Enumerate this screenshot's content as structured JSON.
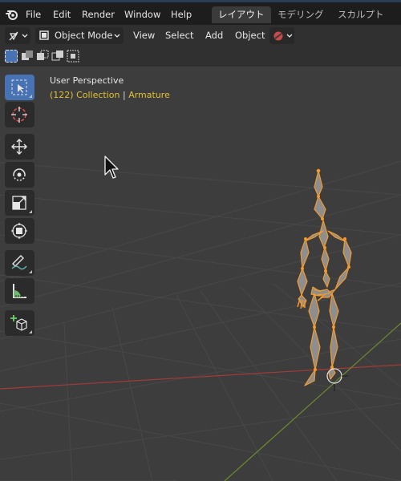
{
  "app": {
    "name": "Blender"
  },
  "top_menu": {
    "items": [
      {
        "label": "File"
      },
      {
        "label": "Edit"
      },
      {
        "label": "Render"
      },
      {
        "label": "Window"
      },
      {
        "label": "Help"
      }
    ]
  },
  "workspace_tabs": [
    {
      "label": "レイアウト",
      "active": true
    },
    {
      "label": "モデリング",
      "active": false
    },
    {
      "label": "スカルプト",
      "active": false
    }
  ],
  "header": {
    "editor_type_icon": "view3d-icon",
    "mode_label": "Object Mode",
    "menus": [
      {
        "label": "View"
      },
      {
        "label": "Select"
      },
      {
        "label": "Add"
      },
      {
        "label": "Object"
      }
    ],
    "overlay_icon": "shading-icon"
  },
  "select_modes": [
    "select-new-icon",
    "select-extend-icon",
    "select-subtract-icon",
    "select-invert-icon",
    "select-intersect-icon"
  ],
  "tools": [
    {
      "name": "select-box-icon",
      "active": true
    },
    {
      "name": "cursor-icon",
      "active": false
    },
    {
      "name": "move-icon",
      "active": false
    },
    {
      "name": "rotate-icon",
      "active": false
    },
    {
      "name": "scale-icon",
      "active": false
    },
    {
      "name": "transform-icon",
      "active": false
    },
    {
      "name": "annotate-icon",
      "active": false
    },
    {
      "name": "measure-icon",
      "active": false
    },
    {
      "name": "add-cube-icon",
      "active": false
    }
  ],
  "viewport": {
    "perspective_label": "User Perspective",
    "collection_label": "(122) Collection",
    "separator": "|",
    "object_label": "Armature"
  },
  "colors": {
    "accent": "#4772b3",
    "selection": "#f29a2e",
    "info_text": "#e0c236",
    "grid_x_axis": "#a43a3a",
    "grid_y_axis": "#6b8a2d"
  }
}
